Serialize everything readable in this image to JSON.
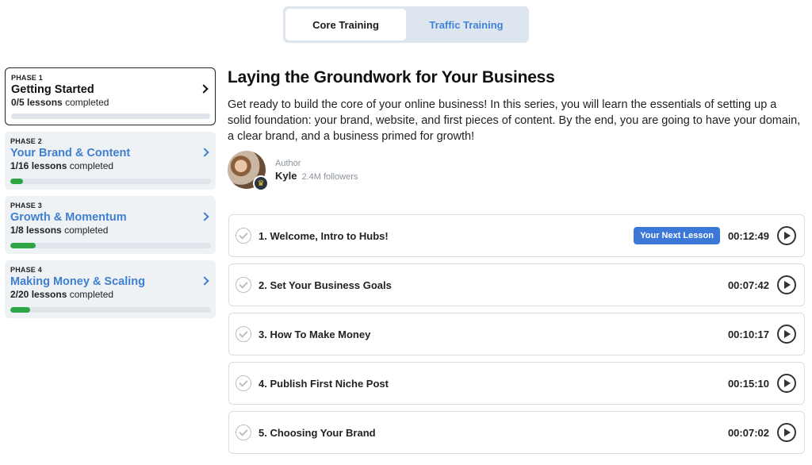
{
  "tabs": [
    {
      "label": "Core Training",
      "active": true
    },
    {
      "label": "Traffic Training",
      "active": false
    }
  ],
  "phases": [
    {
      "phase_label": "PHASE 1",
      "title": "Getting Started",
      "completed": "0/5 lessons",
      "suffix": "completed",
      "progress": 0.0,
      "active": true
    },
    {
      "phase_label": "PHASE 2",
      "title": "Your Brand & Content",
      "completed": "1/16 lessons",
      "suffix": "completed",
      "progress": 0.0625,
      "active": false
    },
    {
      "phase_label": "PHASE 3",
      "title": "Growth & Momentum",
      "completed": "1/8 lessons",
      "suffix": "completed",
      "progress": 0.125,
      "active": false
    },
    {
      "phase_label": "PHASE 4",
      "title": "Making Money & Scaling",
      "completed": "2/20 lessons",
      "suffix": "completed",
      "progress": 0.1,
      "active": false
    }
  ],
  "main": {
    "title": "Laying the Groundwork for Your Business",
    "description": "Get ready to build the core of your online business! In this series, you will learn the essentials of setting up a solid foundation: your brand, website, and first pieces of content. By the end, you are going to have your domain, a clear brand, and a business primed for growth!",
    "author": {
      "label": "Author",
      "name": "Kyle",
      "followers": "2.4M followers"
    }
  },
  "lessons": [
    {
      "title": "1. Welcome, Intro to Hubs!",
      "badge": "Your Next Lesson",
      "duration": "00:12:49"
    },
    {
      "title": "2. Set Your Business Goals",
      "badge": null,
      "duration": "00:07:42"
    },
    {
      "title": "3. How To Make Money",
      "badge": null,
      "duration": "00:10:17"
    },
    {
      "title": "4. Publish First Niche Post",
      "badge": null,
      "duration": "00:15:10"
    },
    {
      "title": "5. Choosing Your Brand",
      "badge": null,
      "duration": "00:07:02"
    }
  ],
  "colors": {
    "accent": "#3f7fcf",
    "progress": "#2ea444",
    "badge": "#3b78d8"
  }
}
